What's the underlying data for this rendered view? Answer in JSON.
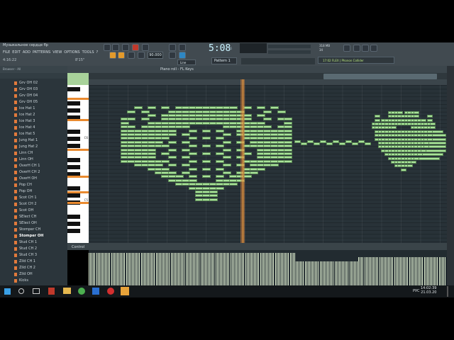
{
  "window": {
    "title": "Музыкальное сердце flp",
    "menu": [
      "FILE",
      "EDIT",
      "ADD",
      "PATTERNS",
      "VIEW",
      "OPTIONS",
      "TOOLS",
      "?"
    ],
    "hint_left": "4:16:22",
    "hint_right": "8'15\""
  },
  "transport": {
    "time": "5:08",
    "time_small": "05",
    "tempo": "90.000",
    "pattern": "Pattern 1",
    "snap": "Line",
    "cpu_ram": "318 MB",
    "cpu_polyphony": "34",
    "hint_bar": "17:02  FLEX | Phonon Collider"
  },
  "browser": {
    "header": "Browser - All",
    "items": [
      "Grv OH 02",
      "Grv OH 03",
      "Grv OH 04",
      "Grv OH 05",
      "Ice Hat 1",
      "Ice Hat 2",
      "Ice Hat 3",
      "Ice Hat 4",
      "Ice Hat 5",
      "Jung Hat 1",
      "Jung Hat 2",
      "Linn CH",
      "Linn OH",
      "OverH CH 1",
      "OverH CH 2",
      "OverH OH",
      "Pop CH",
      "Pop OH",
      "Scot CH 1",
      "Scot CH 2",
      "Scot OH",
      "SElect CH",
      "SElect OH",
      "Stomper CH",
      "Stomper OH",
      "Stud CH 1",
      "Stud CH 2",
      "Stud CH 3",
      "Zild CH 1",
      "Zild CH 2",
      "Zild OH",
      "Kicks"
    ],
    "selected_item": "Stomper OH"
  },
  "piano_roll": {
    "title": "Piano roll - FL Keys",
    "control_label": "Control",
    "key_labels": [
      "C6",
      "C5"
    ]
  },
  "taskbar": {
    "time": "14:02:39",
    "date": "21.03.20",
    "lang": "РУС"
  },
  "colors": {
    "note": "#a9e39a",
    "grid_bg": "#283238",
    "playhead": "#f0a040",
    "accent_orange": "#e17a3c"
  }
}
